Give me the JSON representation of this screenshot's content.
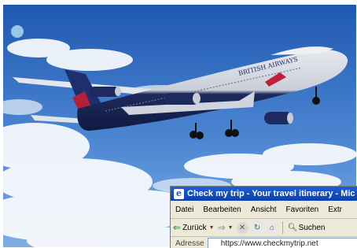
{
  "photo": {
    "livery_text": "BRITISH AIRWAYS"
  },
  "browser": {
    "title": "Check my trip - Your travel itinerary - Mic",
    "menu": [
      "Datei",
      "Bearbeiten",
      "Ansicht",
      "Favoriten",
      "Extr"
    ],
    "toolbar": {
      "back_label": "Zurück",
      "search_label": "Suchen"
    },
    "address": {
      "label": "Adresse",
      "value": "https://www.checkmytrip.net"
    }
  }
}
